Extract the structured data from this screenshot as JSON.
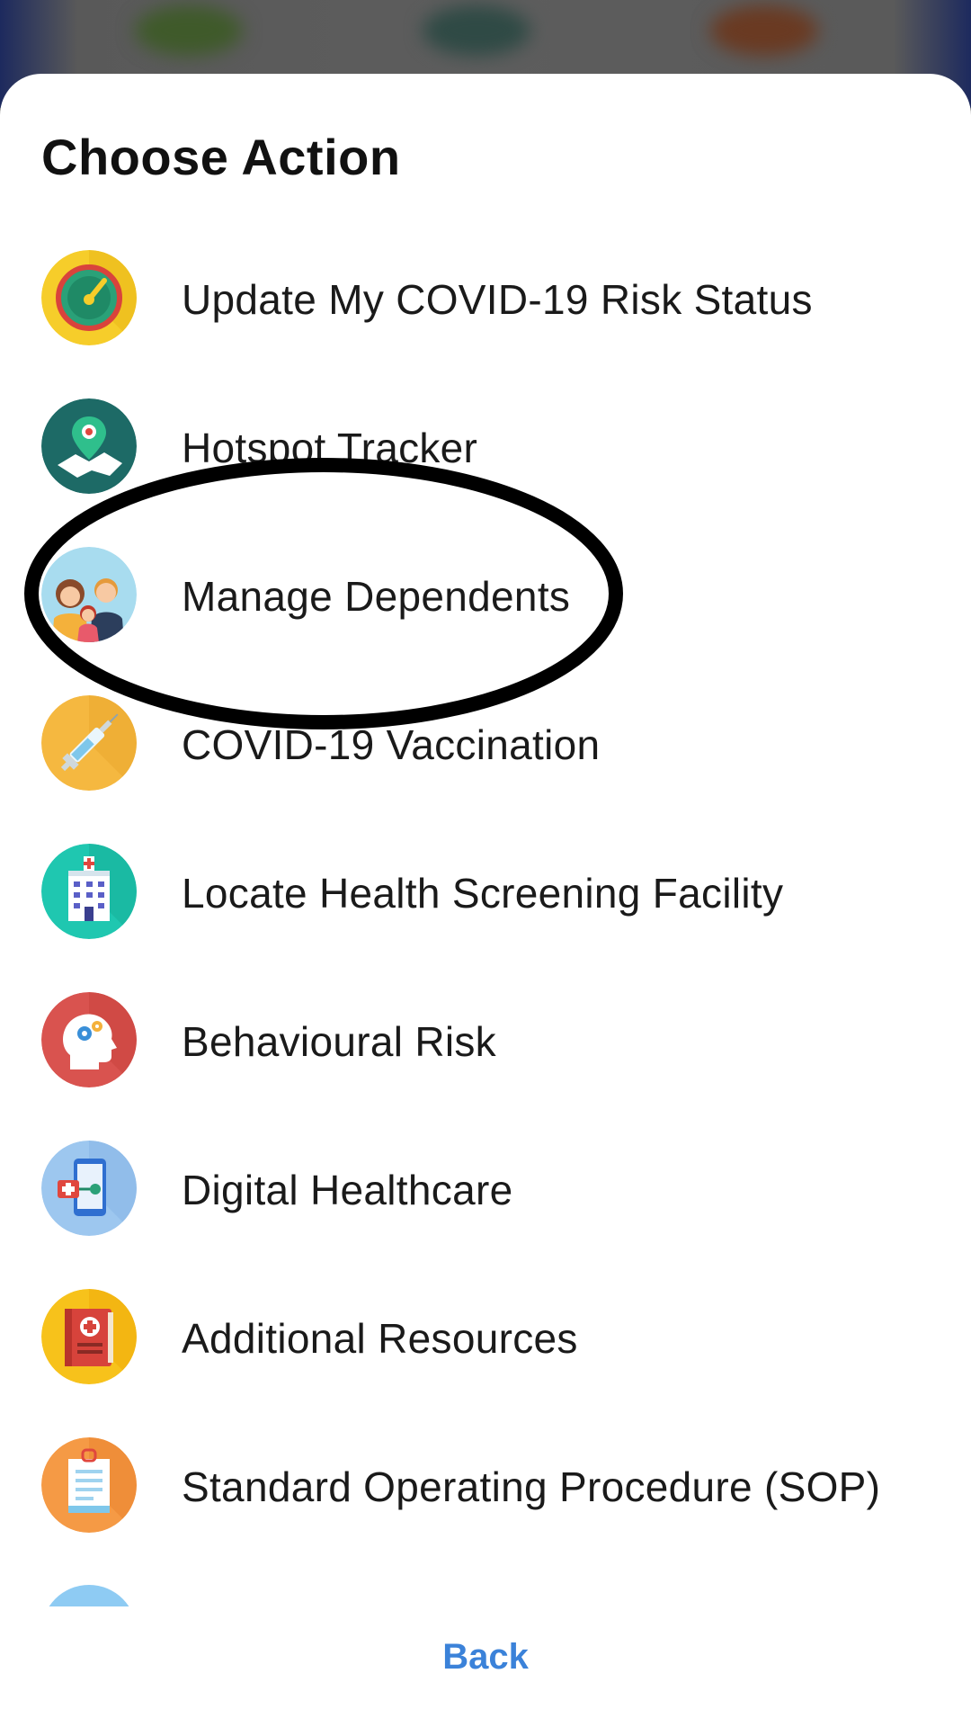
{
  "sheet": {
    "title": "Choose Action",
    "items": [
      {
        "label": "Update My COVID-19 Risk Status",
        "icon": "speedometer-icon"
      },
      {
        "label": "Hotspot Tracker",
        "icon": "map-pin-icon"
      },
      {
        "label": "Manage Dependents",
        "icon": "family-icon"
      },
      {
        "label": "COVID-19 Vaccination",
        "icon": "syringe-icon"
      },
      {
        "label": "Locate Health Screening Facility",
        "icon": "hospital-icon"
      },
      {
        "label": "Behavioural Risk",
        "icon": "head-gears-icon"
      },
      {
        "label": "Digital Healthcare",
        "icon": "phone-health-icon"
      },
      {
        "label": "Additional Resources",
        "icon": "medical-book-icon"
      },
      {
        "label": "Standard Operating Procedure (SOP)",
        "icon": "clipboard-icon"
      }
    ],
    "back_label": "Back"
  },
  "colors": {
    "accent": "#3b82d9",
    "annotation": "#000000"
  }
}
